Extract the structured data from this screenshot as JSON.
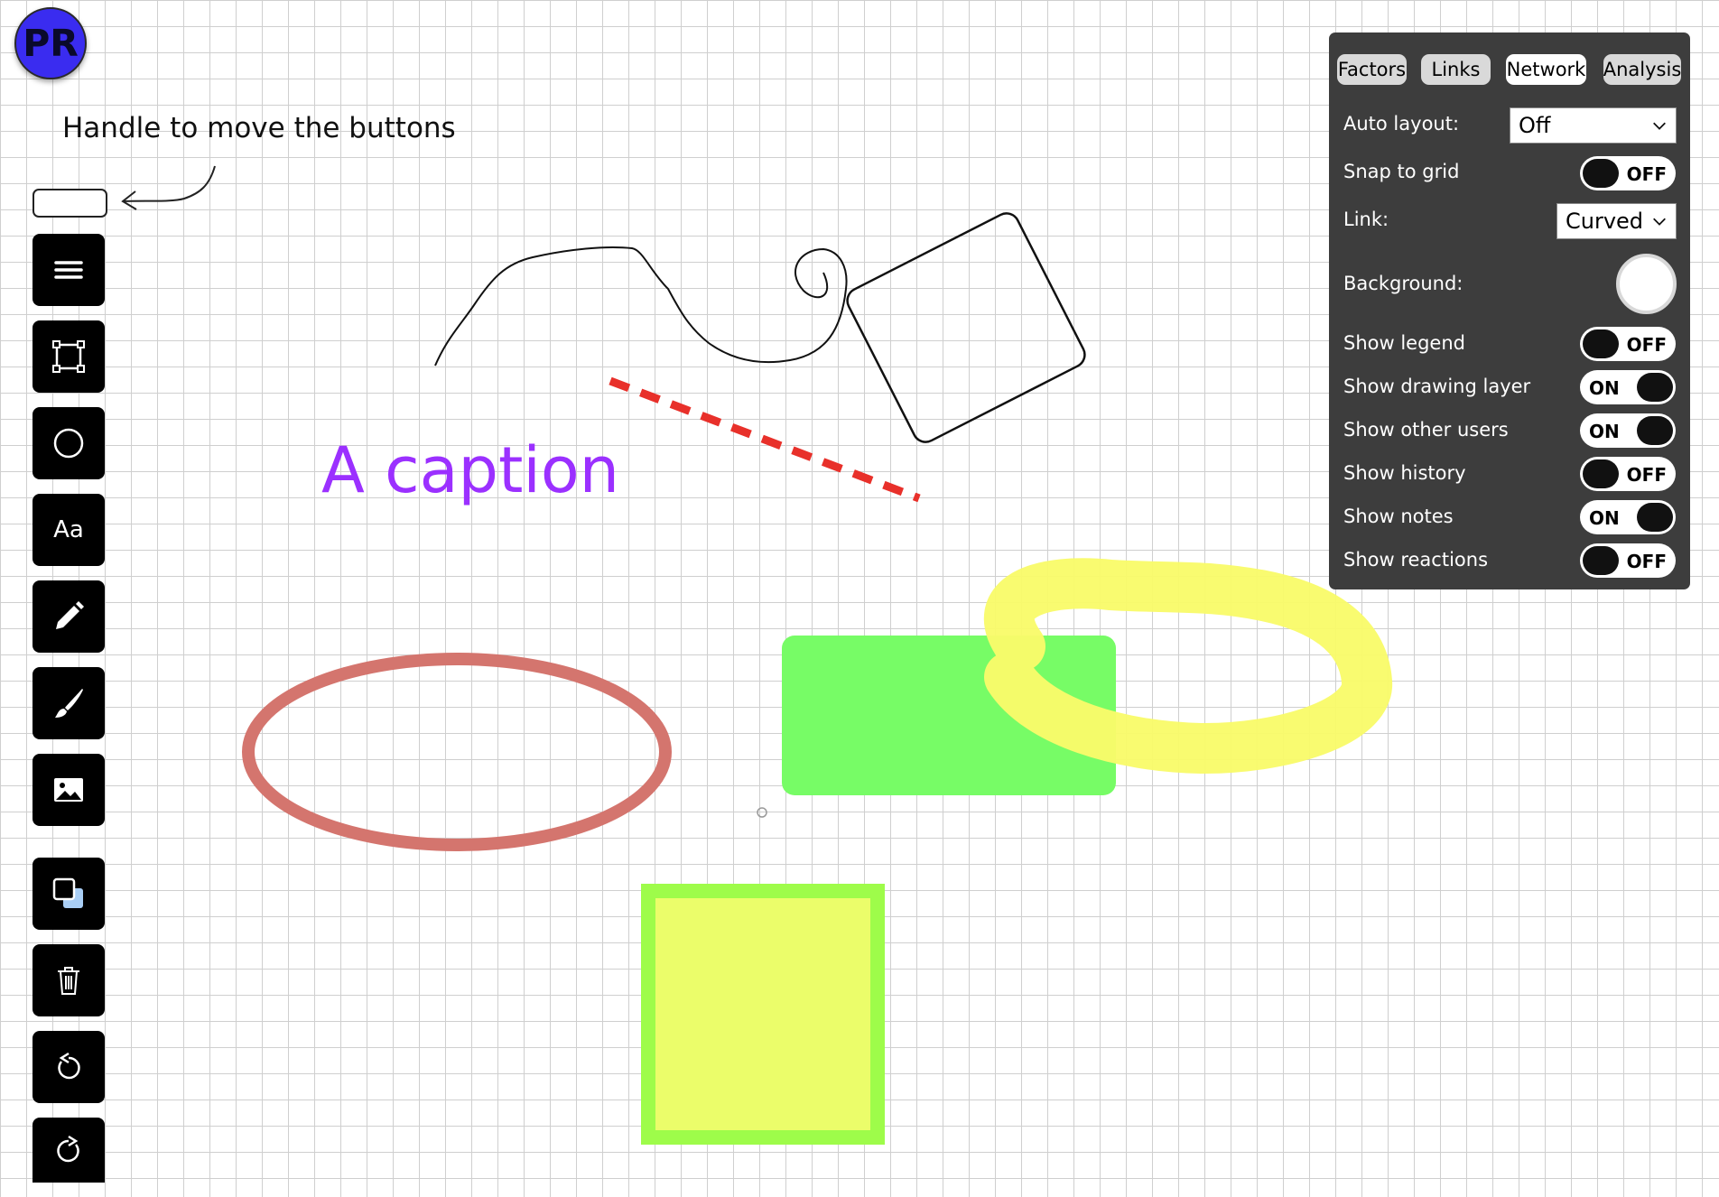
{
  "avatar": {
    "initials": "PR",
    "color": "#3a2cf0"
  },
  "handle": {
    "label": "Handle to move the buttons"
  },
  "toolbar": {
    "items": [
      {
        "name": "menu",
        "icon": "hamburger-menu-icon"
      },
      {
        "name": "rectangle",
        "icon": "rectangle-select-icon"
      },
      {
        "name": "ellipse",
        "icon": "circle-icon"
      },
      {
        "name": "text",
        "icon": "text-icon",
        "label": "Aa"
      },
      {
        "name": "pencil",
        "icon": "pencil-icon"
      },
      {
        "name": "brush",
        "icon": "brush-icon"
      },
      {
        "name": "image",
        "icon": "image-icon"
      },
      {
        "name": "bring-front",
        "icon": "layers-icon"
      },
      {
        "name": "delete",
        "icon": "trash-icon"
      },
      {
        "name": "undo",
        "icon": "undo-icon"
      },
      {
        "name": "redo",
        "icon": "redo-icon"
      }
    ]
  },
  "canvas": {
    "caption": "A caption",
    "colors": {
      "caption": "#9b30ff",
      "dashed_line": "#e8302a",
      "ellipse_stroke": "#d4756e",
      "green_rect": "#77fc66",
      "yellow_rect_fill": "#ebfd6a",
      "yellow_rect_border": "#9efc4a",
      "highlighter": "#f9fb6a"
    }
  },
  "panel": {
    "tabs": [
      {
        "label": "Factors",
        "active": false
      },
      {
        "label": "Links",
        "active": false
      },
      {
        "label": "Network",
        "active": true
      },
      {
        "label": "Analysis",
        "active": false
      }
    ],
    "auto_layout": {
      "label": "Auto layout:",
      "value": "Off"
    },
    "snap_to_grid": {
      "label": "Snap to grid",
      "state": "OFF"
    },
    "link": {
      "label": "Link:",
      "value": "Curved"
    },
    "background": {
      "label": "Background:",
      "color": "#ffffff"
    },
    "toggles": [
      {
        "label": "Show legend",
        "state": "OFF"
      },
      {
        "label": "Show drawing layer",
        "state": "ON"
      },
      {
        "label": "Show other users",
        "state": "ON"
      },
      {
        "label": "Show history",
        "state": "OFF"
      },
      {
        "label": "Show notes",
        "state": "ON"
      },
      {
        "label": "Show reactions",
        "state": "OFF"
      }
    ]
  }
}
